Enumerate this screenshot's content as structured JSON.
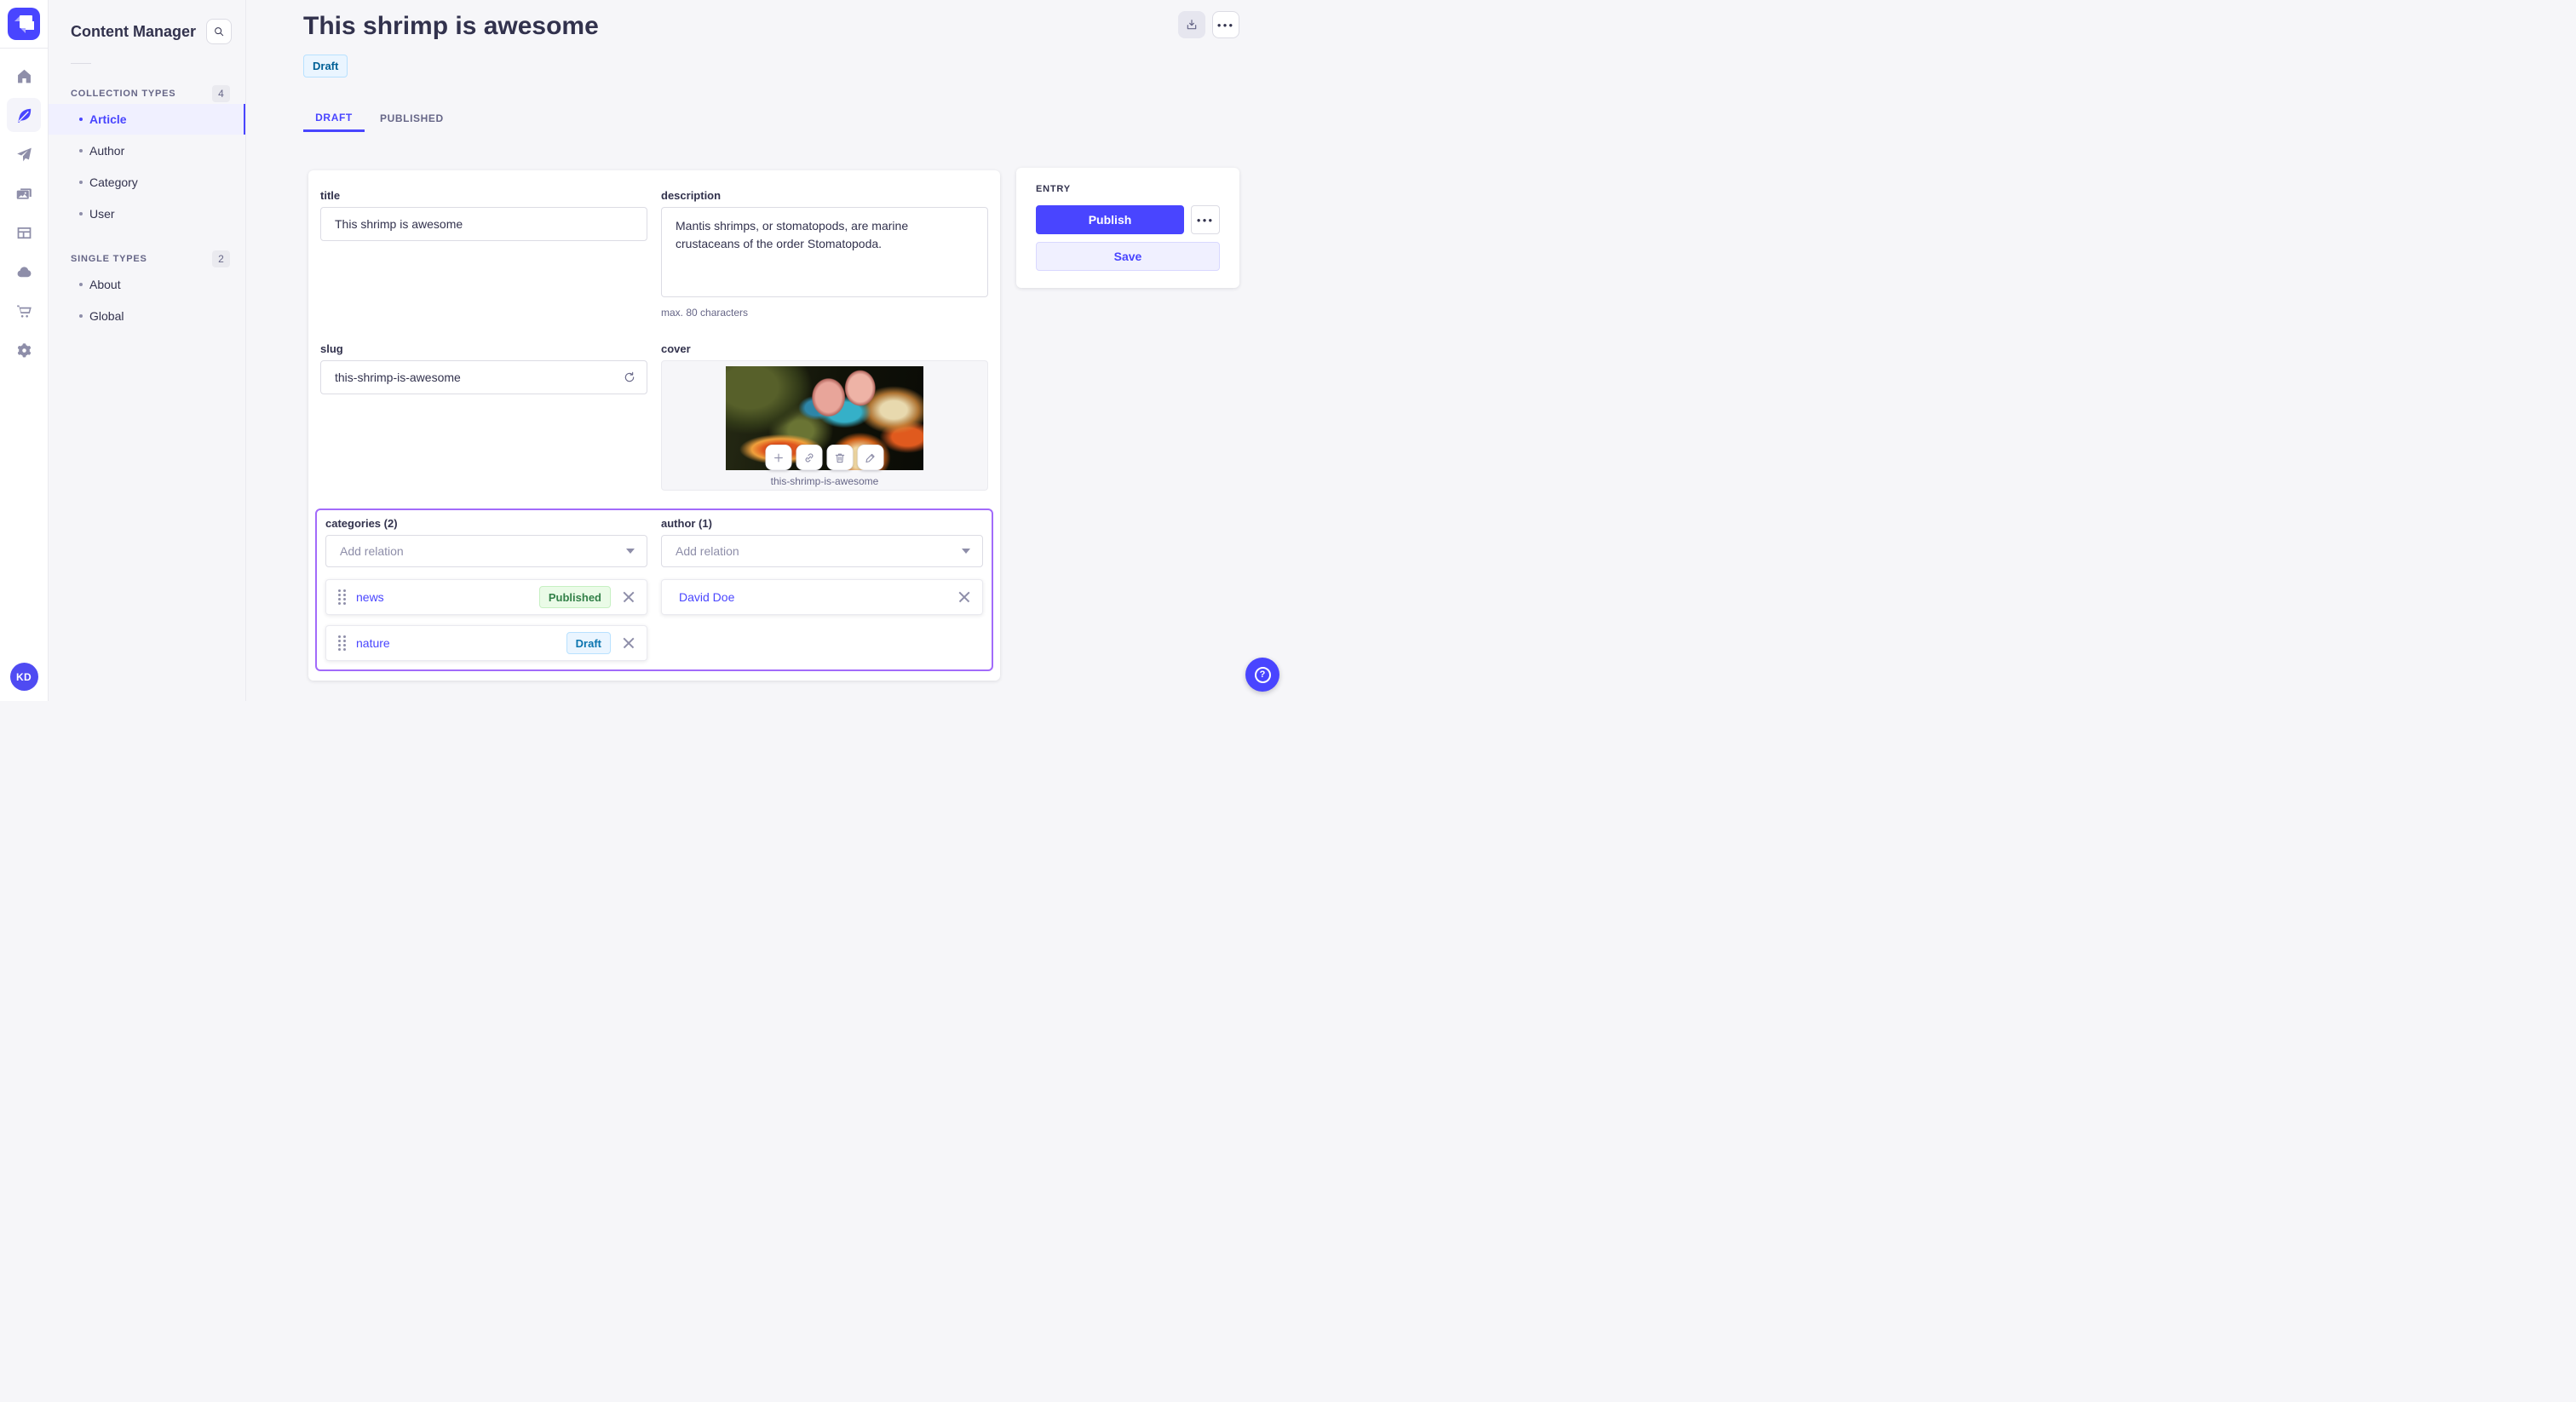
{
  "navbar": {
    "logo_name": "strapi-logo",
    "icons": [
      "home-icon",
      "content-manager-feather-icon",
      "send-plane-icon",
      "media-library-icon",
      "layout-icon",
      "cloud-icon",
      "marketplace-cart-icon",
      "settings-gear-icon"
    ],
    "avatar_initials": "KD"
  },
  "sidebar": {
    "title": "Content Manager",
    "search_icon": "search-icon",
    "collection_types": {
      "label": "COLLECTION TYPES",
      "count": "4",
      "items": [
        {
          "label": "Article",
          "active": true
        },
        {
          "label": "Author",
          "active": false
        },
        {
          "label": "Category",
          "active": false
        },
        {
          "label": "User",
          "active": false
        }
      ]
    },
    "single_types": {
      "label": "SINGLE TYPES",
      "count": "2",
      "items": [
        {
          "label": "About",
          "active": false
        },
        {
          "label": "Global",
          "active": false
        }
      ]
    }
  },
  "header": {
    "title": "This shrimp is awesome",
    "status_badge": "Draft",
    "more_glyph": "●●●",
    "tabs": [
      {
        "label": "DRAFT",
        "active": true
      },
      {
        "label": "PUBLISHED",
        "active": false
      }
    ]
  },
  "form": {
    "title": {
      "label": "title",
      "value": "This shrimp is awesome"
    },
    "description": {
      "label": "description",
      "value": "Mantis shrimps, or stomatopods, are marine crustaceans of the order Stomatopoda.",
      "hint": "max. 80 characters"
    },
    "slug": {
      "label": "slug",
      "value": "this-shrimp-is-awesome"
    },
    "cover": {
      "label": "cover",
      "caption": "this-shrimp-is-awesome"
    },
    "categories": {
      "label": "categories (2)",
      "placeholder": "Add relation",
      "items": [
        {
          "name": "news",
          "status": "Published"
        },
        {
          "name": "nature",
          "status": "Draft"
        }
      ]
    },
    "author": {
      "label": "author (1)",
      "placeholder": "Add relation",
      "items": [
        {
          "name": "David Doe"
        }
      ]
    }
  },
  "entry_panel": {
    "title": "ENTRY",
    "publish_label": "Publish",
    "save_label": "Save",
    "more_glyph": "●●●"
  },
  "colors": {
    "primary": "#4945ff",
    "relation_focus_border": "#a26bfa",
    "published_green": "#328048",
    "draft_blue": "#006096",
    "background": "#f6f6f9"
  }
}
